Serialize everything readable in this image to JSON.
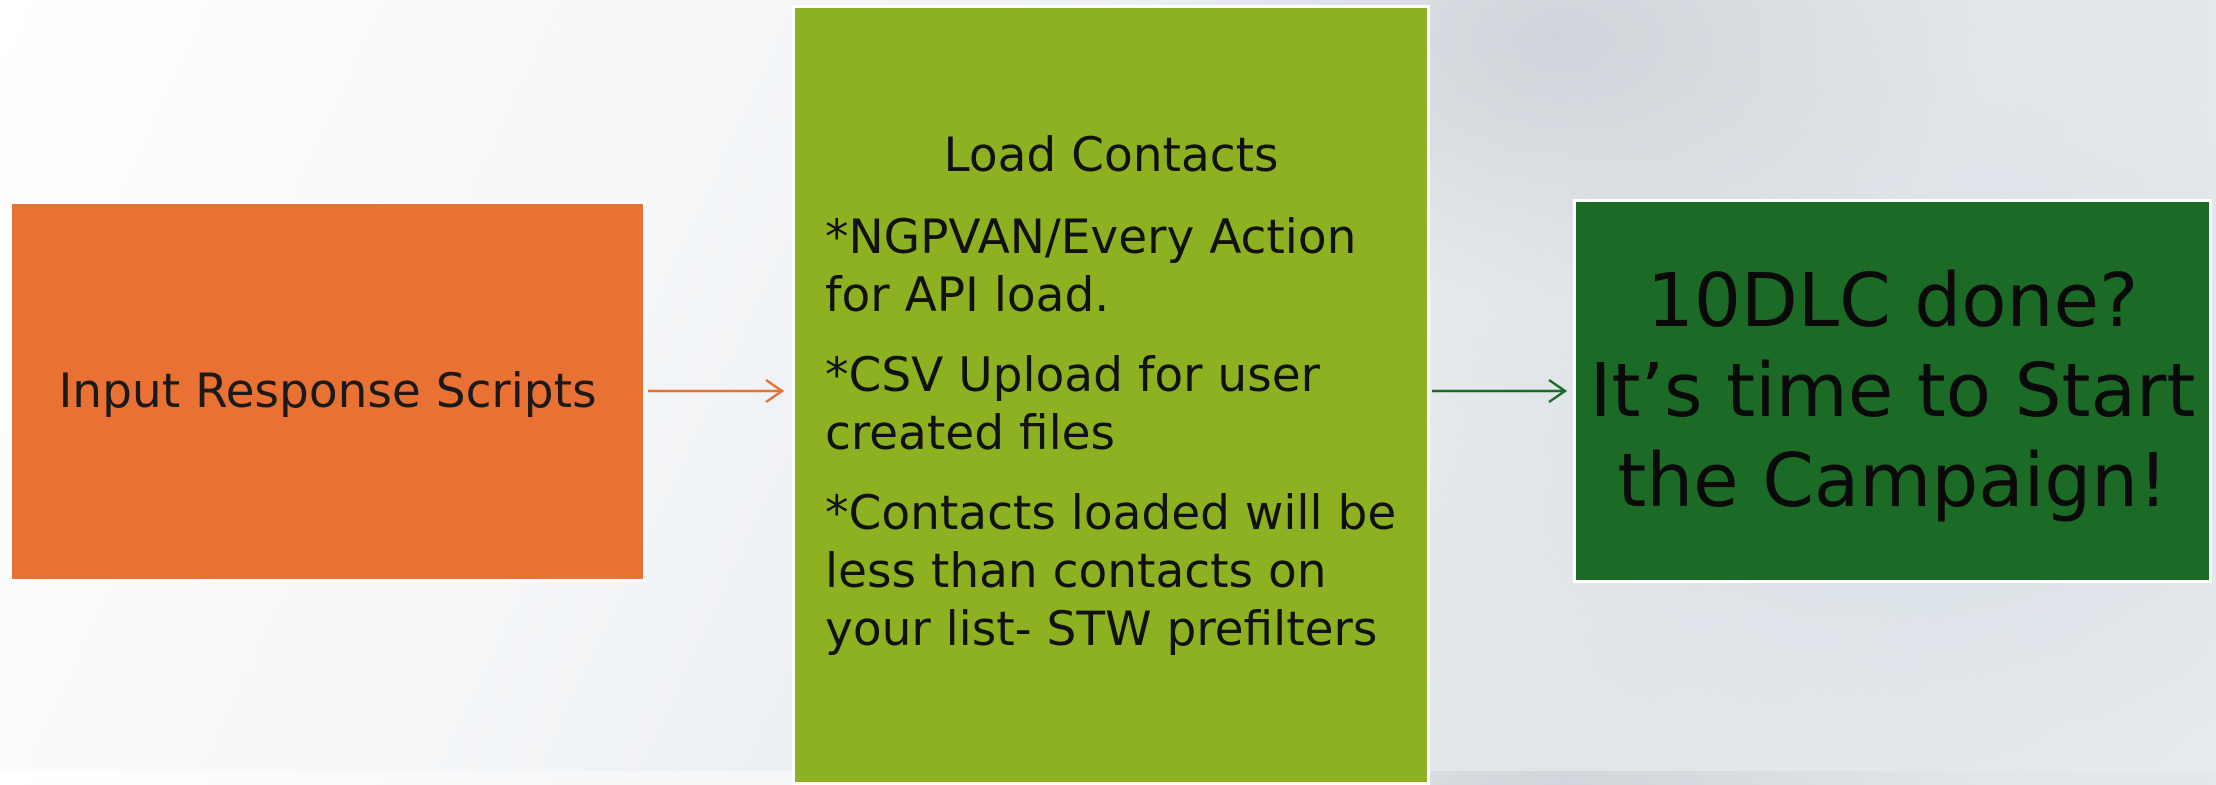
{
  "diagram": {
    "nodes": [
      {
        "id": "input-response-scripts",
        "label": "Input Response Scripts",
        "color": "#e97134"
      },
      {
        "id": "load-contacts",
        "title": "Load Contacts",
        "items": [
          "*NGPVAN/Every Action for API load.",
          "*CSV Upload for user created files",
          "*Contacts loaded will be less than contacts on your list- STW prefilters"
        ],
        "color": "#8db120"
      },
      {
        "id": "start-campaign",
        "lines": [
          "10DLC done?",
          "It’s time to Start",
          "the Campaign!"
        ],
        "color": "#1b6b26"
      }
    ],
    "edges": [
      {
        "from": "input-response-scripts",
        "to": "load-contacts",
        "color": "#e97134"
      },
      {
        "from": "load-contacts",
        "to": "start-campaign",
        "color": "#1b6b26"
      }
    ]
  }
}
